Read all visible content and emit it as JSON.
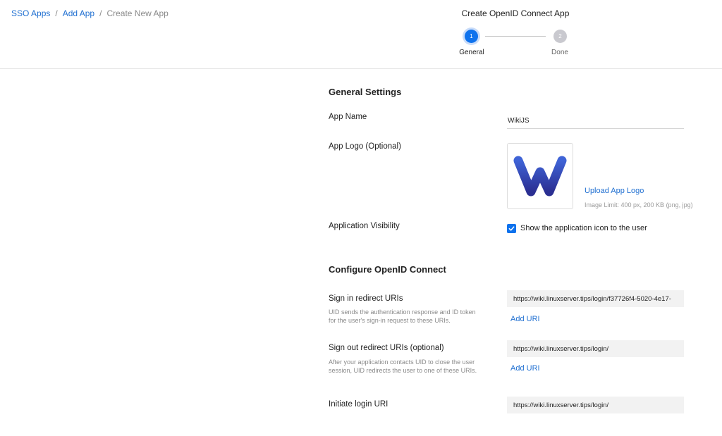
{
  "breadcrumb": {
    "items": [
      "SSO Apps",
      "Add App"
    ],
    "separator": "/",
    "current": "Create New App"
  },
  "wizard": {
    "title": "Create OpenID Connect App",
    "steps": [
      {
        "number": "1",
        "label": "General",
        "state": "active"
      },
      {
        "number": "2",
        "label": "Done",
        "state": "inactive"
      }
    ]
  },
  "general": {
    "title": "General Settings",
    "app_name_label": "App Name",
    "app_name_value": "WikiJS",
    "app_logo_label": "App Logo (Optional)",
    "upload_logo_link": "Upload App Logo",
    "image_limit": "Image Limit: 400 px, 200 KB (png, jpg)",
    "visibility_label": "Application Visibility",
    "visibility_checkbox_label": "Show the application icon to the user",
    "visibility_checked": true
  },
  "oidc": {
    "title": "Configure OpenID Connect",
    "signin_label": "Sign in redirect URIs",
    "signin_help": "UID sends the authentication response and ID token for the user's sign-in request to these URIs.",
    "signin_value": "https://wiki.linuxserver.tips/login/f37726f4-5020-4e17-",
    "signin_add": "Add URI",
    "signout_label": "Sign out redirect URIs (optional)",
    "signout_help": "After your application contacts UID to close the user session, UID redirects the user to one of these URIs.",
    "signout_value": "https://wiki.linuxserver.tips/login/",
    "signout_add": "Add URI",
    "initiate_label": "Initiate login URI",
    "initiate_value": "https://wiki.linuxserver.tips/login/"
  },
  "colors": {
    "accent": "#0e72ed",
    "link": "#1f6fd1",
    "logo_gradient_start": "#3b5fd0",
    "logo_gradient_end": "#2a2f8f"
  },
  "icons": {
    "logo": "wikijs-w-logo",
    "checkbox": "check-icon"
  }
}
